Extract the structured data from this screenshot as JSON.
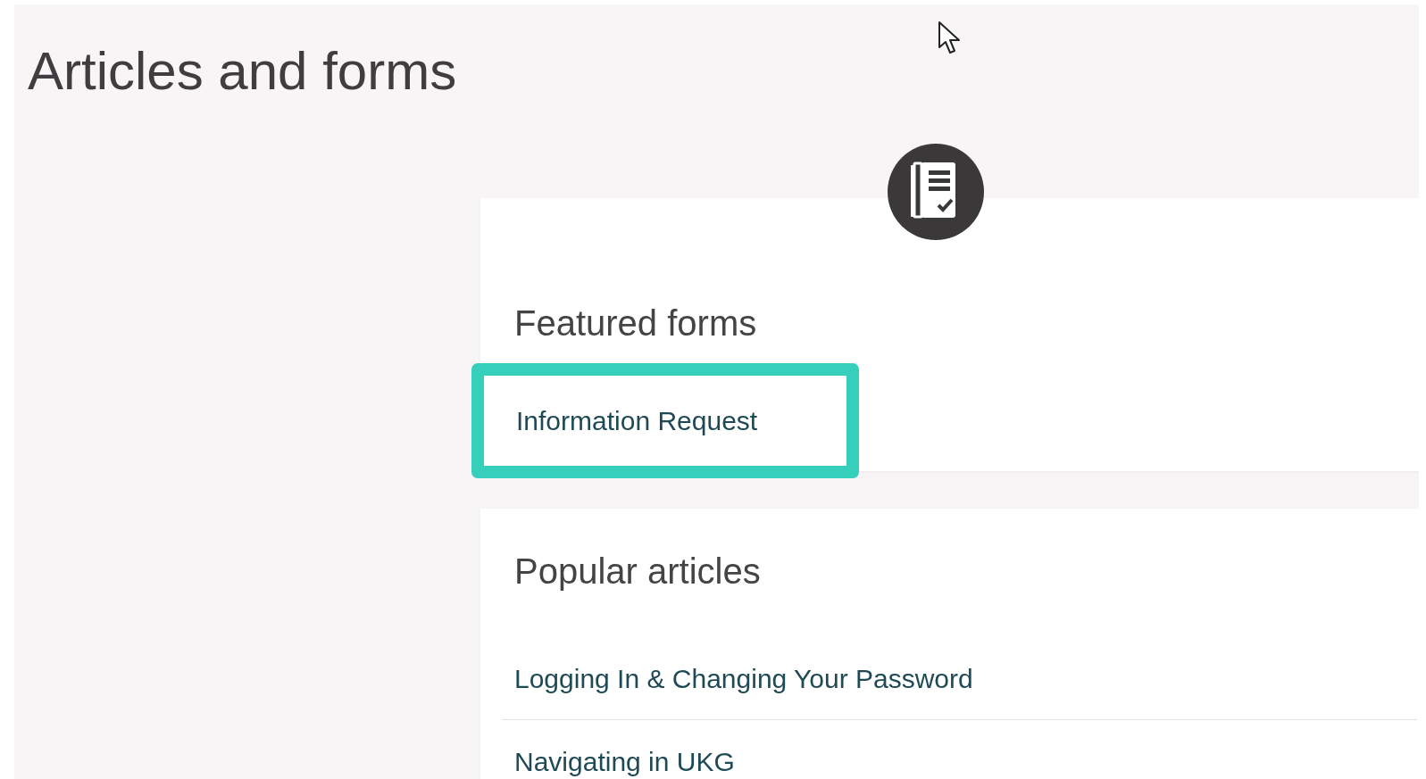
{
  "page": {
    "title": "Articles and forms"
  },
  "featured_forms": {
    "heading": "Featured forms",
    "items": [
      {
        "label": "Information Request",
        "highlighted": true
      }
    ]
  },
  "popular_articles": {
    "heading": "Popular articles",
    "items": [
      {
        "label": "Logging In & Changing Your Password"
      },
      {
        "label": "Navigating in UKG"
      }
    ]
  }
}
